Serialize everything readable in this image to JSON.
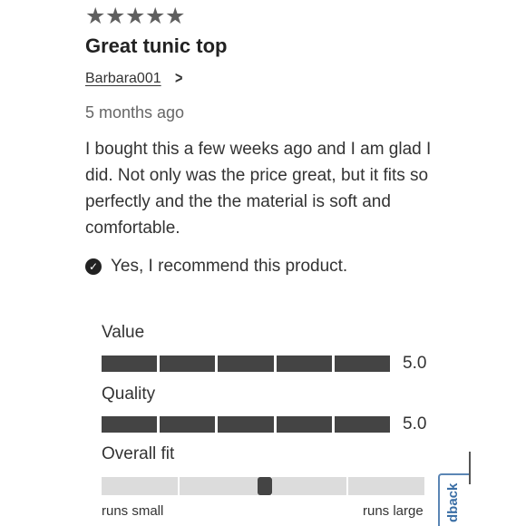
{
  "review": {
    "star_rating": 5,
    "stars": [
      "★",
      "★",
      "★",
      "★",
      "★"
    ],
    "title": "Great tunic top",
    "author": "Barbara001",
    "date": "5 months ago",
    "body": "I bought this a few weeks ago and I am glad I did. Not only was the price great, but it fits so perfectly and the the material is soft and comfortable.",
    "recommend_text": "Yes, I recommend this product.",
    "icons": {
      "star": "star-icon",
      "chevron": "chevron-right-icon",
      "check": "check-circle-icon"
    }
  },
  "ratings": [
    {
      "label": "Value",
      "value": "5.0",
      "score": 5,
      "max": 5
    },
    {
      "label": "Quality",
      "value": "5.0",
      "score": 5,
      "max": 5
    }
  ],
  "fit": {
    "label": "Overall fit",
    "low_label": "runs small",
    "high_label": "runs large",
    "position_fraction": 0.5
  },
  "feedback_tab": {
    "label": "dback"
  },
  "colors": {
    "filled": "#444444",
    "empty": "#d8d8d8",
    "accent": "#3a6ea5"
  }
}
